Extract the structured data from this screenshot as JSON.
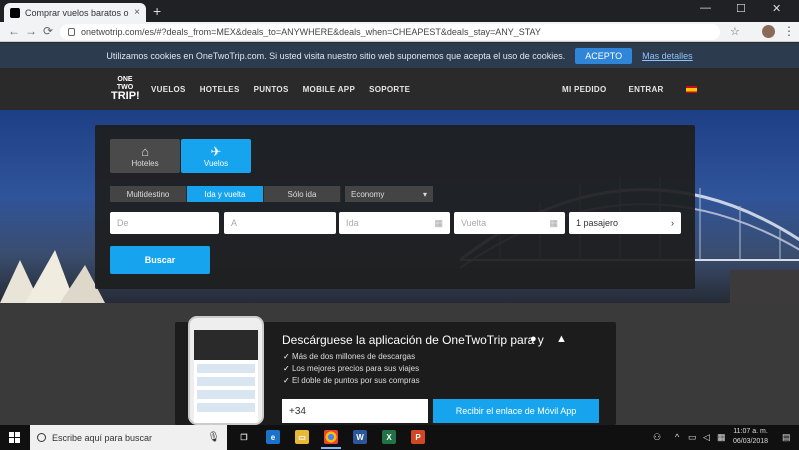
{
  "browser": {
    "tab_title": "Comprar vuelos baratos online a...",
    "tab_close": "×",
    "new_tab": "+",
    "window_controls": [
      "—",
      "☐",
      "✕"
    ],
    "back": "←",
    "forward": "→",
    "reload": "⟳",
    "url": "onetwotrip.com/es/#?deals_from=MEX&deals_to=ANYWHERE&deals_when=CHEAPEST&deals_stay=ANY_STAY",
    "star": "☆",
    "menu": "⋮"
  },
  "cookie_bar": {
    "text": "Utilizamos cookies en OneTwoTrip.com. Si usted visita nuestro sitio web suponemos que acepta el uso de cookies.",
    "accept_label": "ACEPTO",
    "more_label": "Mas detalles"
  },
  "header": {
    "logo_top": "ONE TWO",
    "logo_bottom": "TRIP!",
    "nav": [
      "VUELOS",
      "HOTELES",
      "PUNTOS",
      "MOBILE APP",
      "SOPORTE"
    ],
    "my_order": "MI PEDIDO",
    "login": "ENTRAR",
    "colors": {
      "accent": "#17a4ef",
      "header_bg": "#2a2a2a",
      "cookie_bg": "#2c3b4e"
    }
  },
  "search": {
    "tabs": [
      {
        "label": "Hoteles",
        "icon": "bed-icon",
        "glyph": "⌂"
      },
      {
        "label": "Vuelos",
        "icon": "airplane-icon",
        "glyph": "✈"
      }
    ],
    "trip_types": [
      "Multidestino",
      "Ida y vuelta",
      "Sólo ida"
    ],
    "class_select": "Economy",
    "from_placeholder": "De",
    "to_placeholder": "A",
    "depart_placeholder": "Ida",
    "return_placeholder": "Vuelta",
    "passengers": "1 pasajero",
    "search_label": "Buscar"
  },
  "promo": {
    "title": "Descárguese la aplicación de OneTwoTrip para  y ",
    "apple_icon": "apple-icon",
    "android_icon": "android-icon",
    "bullets": [
      "Más de dos millones de descargas",
      "Los mejores precios para sus viajes",
      "El doble de puntos por sus compras"
    ],
    "phone_prefix": "+34",
    "send_label": "Recibir el enlace de Móvil App"
  },
  "taskbar": {
    "search_placeholder": "Escribe aquí para buscar",
    "time": "11:07 a. m.",
    "date": "06/03/2018",
    "apps": [
      "task-view-icon",
      "edge-icon",
      "file-explorer-icon",
      "chrome-icon",
      "word-icon",
      "excel-icon",
      "powerpoint-icon"
    ]
  }
}
